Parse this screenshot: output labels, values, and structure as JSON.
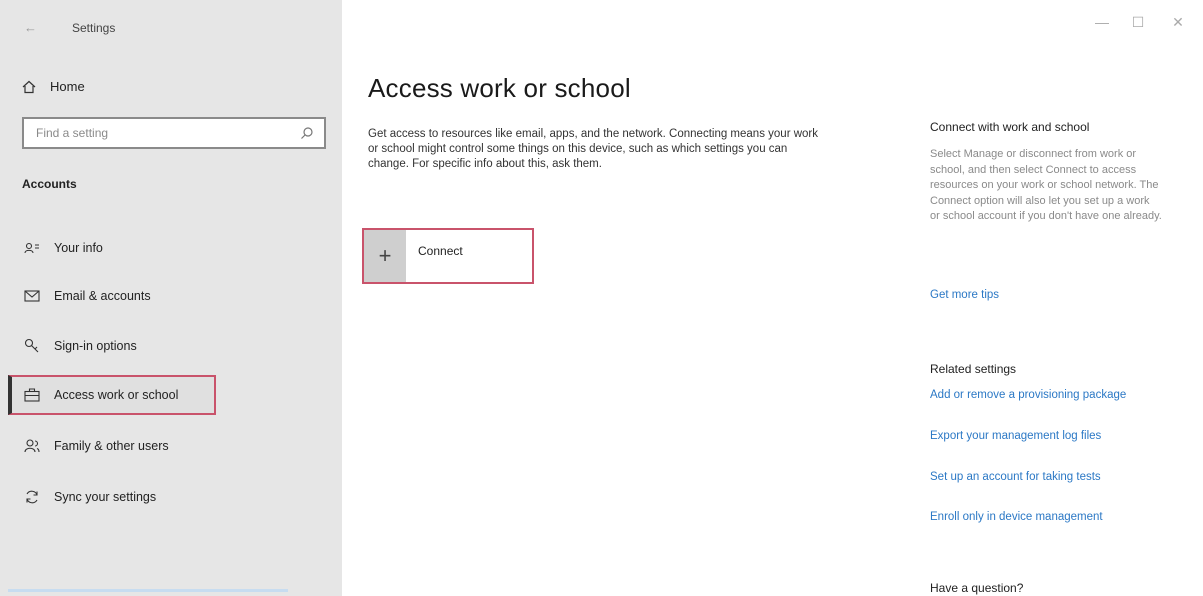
{
  "window": {
    "title": "Settings",
    "back_glyph": "←",
    "minimize_glyph": "—",
    "maximize_glyph": "☐",
    "close_glyph": "✕"
  },
  "sidebar": {
    "home_label": "Home",
    "search_placeholder": "Find a setting",
    "section_label": "Accounts",
    "items": [
      {
        "label": "Your info",
        "icon": "person-card-icon"
      },
      {
        "label": "Email & accounts",
        "icon": "mail-icon"
      },
      {
        "label": "Sign-in options",
        "icon": "key-icon"
      },
      {
        "label": "Access work or school",
        "icon": "briefcase-icon",
        "active": true
      },
      {
        "label": "Family & other users",
        "icon": "people-icon"
      },
      {
        "label": "Sync your settings",
        "icon": "sync-icon"
      }
    ]
  },
  "main": {
    "title": "Access work or school",
    "description": "Get access to resources like email, apps, and the network. Connecting means your work or school might control some things on this device, such as which settings you can change. For specific info about this, ask them.",
    "connect_label": "Connect",
    "connect_glyph": "+"
  },
  "right_panel": {
    "connect_heading": "Connect with work and school",
    "connect_text": "Select Manage or disconnect from work or school, and then select Connect to access resources on your work or school network. The Connect option will also let you set up a work or school account if you don't have one already.",
    "tips_link": "Get more tips",
    "related_heading": "Related settings",
    "related_links": [
      "Add or remove a provisioning package",
      "Export your management log files",
      "Set up an account for taking tests",
      "Enroll only in device management"
    ],
    "question_heading": "Have a question?"
  },
  "colors": {
    "sidebar_bg": "#e6e6e6",
    "highlight_border": "#c9536b",
    "link": "#2b78c5"
  }
}
